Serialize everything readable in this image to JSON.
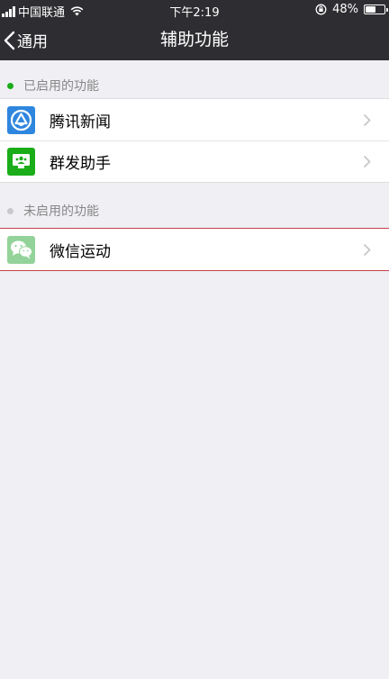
{
  "status_bar": {
    "carrier": "中国联通",
    "time": "下午2:19",
    "battery_percent_text": "48%",
    "battery_level": 0.48
  },
  "nav": {
    "back_label": "通用",
    "title": "辅助功能"
  },
  "sections": {
    "enabled": {
      "title": "已启用的功能",
      "dot_color": "#1aad19",
      "items": [
        {
          "label": "腾讯新闻",
          "icon": "tencent-news-icon",
          "icon_color": "#2e86de"
        },
        {
          "label": "群发助手",
          "icon": "broadcast-assistant-icon",
          "icon_color": "#1aad19"
        }
      ]
    },
    "disabled": {
      "title": "未启用的功能",
      "dot_color": "#c8c8cd",
      "items": [
        {
          "label": "微信运动",
          "icon": "wechat-sports-icon",
          "icon_color": "#93d39a"
        }
      ]
    }
  }
}
